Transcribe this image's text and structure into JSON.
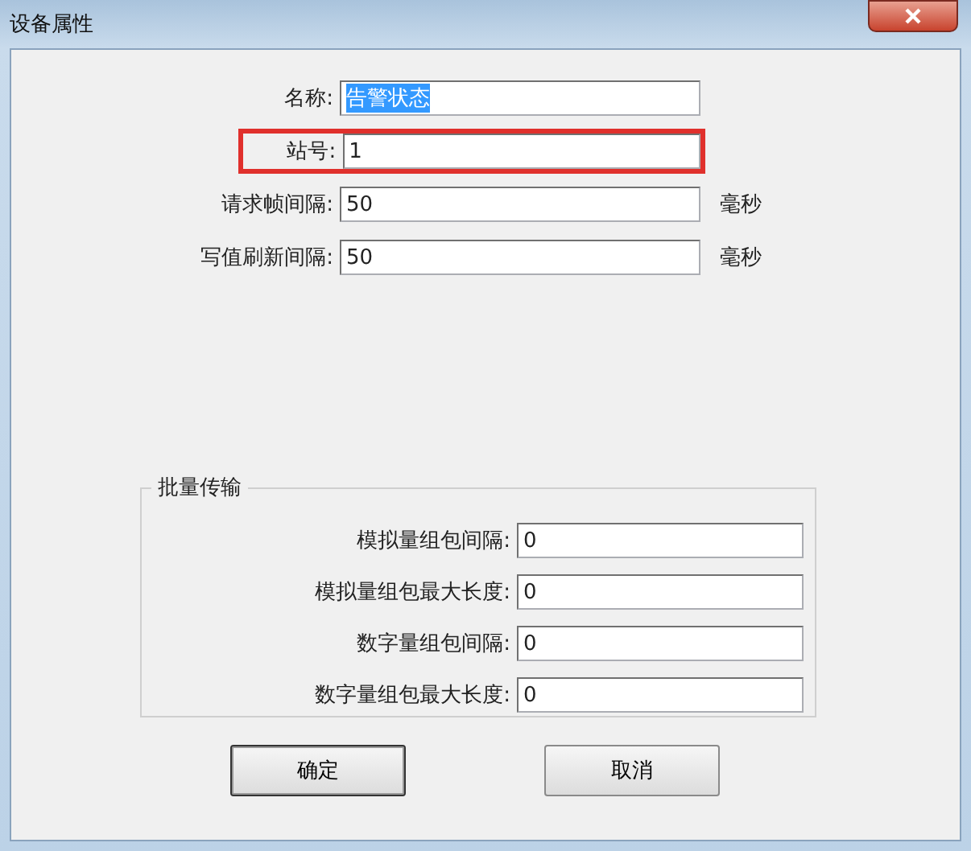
{
  "window": {
    "title": "设备属性"
  },
  "fields": [
    {
      "label": "名称:",
      "value": "告警状态",
      "selected": true,
      "highlighted": false
    },
    {
      "label": "站号:",
      "value": "1",
      "selected": false,
      "highlighted": true
    },
    {
      "label": "请求帧间隔:",
      "value": "50",
      "unit": "毫秒",
      "selected": false,
      "highlighted": false
    },
    {
      "label": "写值刷新间隔:",
      "value": "50",
      "unit": "毫秒",
      "selected": false,
      "highlighted": false
    }
  ],
  "group": {
    "title": "批量传输",
    "fields": [
      {
        "label": "模拟量组包间隔:",
        "value": "0"
      },
      {
        "label": "模拟量组包最大长度:",
        "value": "0"
      },
      {
        "label": "数字量组包间隔:",
        "value": "0"
      },
      {
        "label": "数字量组包最大长度:",
        "value": "0"
      }
    ]
  },
  "buttons": [
    {
      "label": "确定",
      "default": true
    },
    {
      "label": "取消",
      "default": false
    }
  ]
}
